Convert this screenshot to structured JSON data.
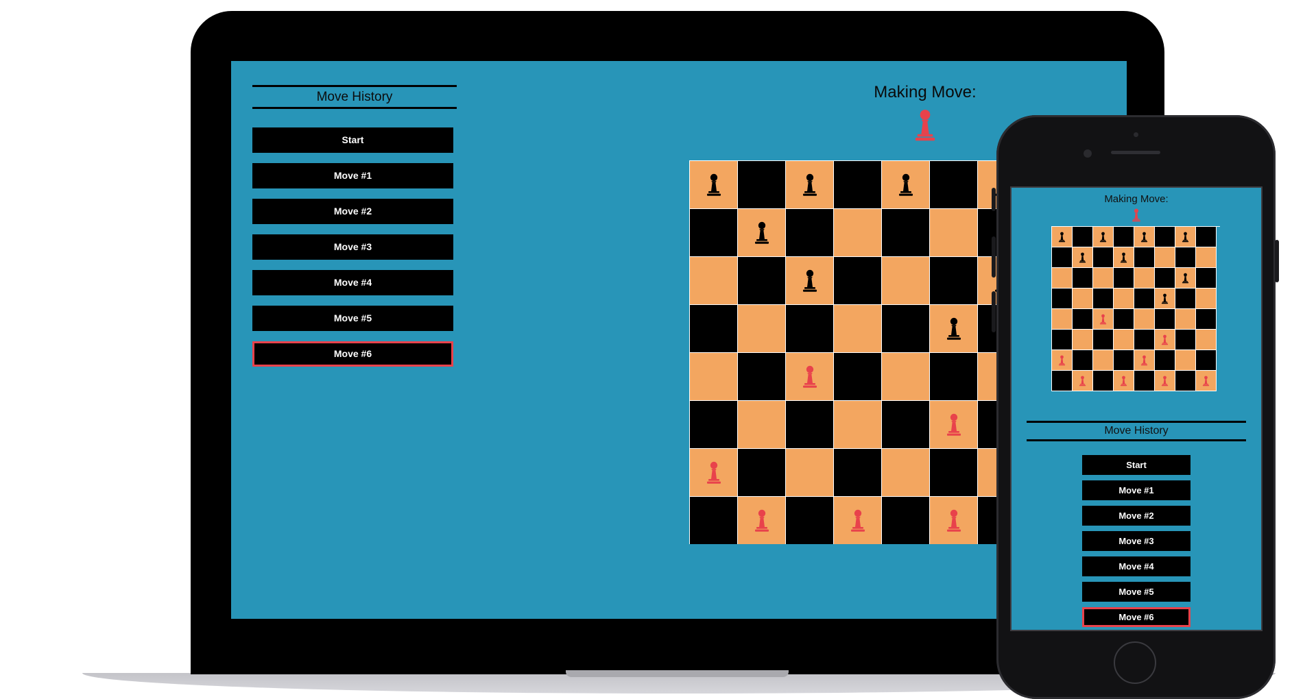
{
  "colors": {
    "background": "#2895b8",
    "light_square": "#f3a660",
    "dark_square": "#000000",
    "black_piece": "#000000",
    "red_piece": "#e8424b",
    "selected_border": "#e8424b"
  },
  "desktop": {
    "history_title": "Move History",
    "moves": [
      "Start",
      "Move #1",
      "Move #2",
      "Move #3",
      "Move #4",
      "Move #5",
      "Move #6"
    ],
    "selected_move": 6,
    "making_move_label": "Making Move:",
    "current_player": "red",
    "board_visible_columns": 6
  },
  "mobile": {
    "history_title": "Move History",
    "moves": [
      "Start",
      "Move #1",
      "Move #2",
      "Move #3",
      "Move #4",
      "Move #5",
      "Move #6"
    ],
    "selected_move": 6,
    "making_move_label": "Making Move:",
    "current_player": "red"
  },
  "board": {
    "icon": "pawn-icon",
    "rows": [
      [
        "b",
        "",
        "b",
        "",
        "b",
        "",
        "b",
        ""
      ],
      [
        "",
        "b",
        "",
        "",
        "",
        "",
        "",
        ""
      ],
      [
        "",
        "",
        "b",
        "",
        "",
        "",
        "b",
        ""
      ],
      [
        "",
        "",
        "",
        "",
        "",
        "b",
        "",
        ""
      ],
      [
        "",
        "",
        "r",
        "",
        "",
        "",
        "",
        ""
      ],
      [
        "",
        "",
        "",
        "",
        "",
        "r",
        "",
        ""
      ],
      [
        "r",
        "",
        "",
        "",
        "",
        "",
        "",
        ""
      ],
      [
        "",
        "r",
        "",
        "r",
        "",
        "r",
        "",
        "r"
      ]
    ]
  },
  "mobile_board": {
    "rows": [
      [
        "b",
        "",
        "b",
        "",
        "b",
        "",
        "b",
        ""
      ],
      [
        "",
        "b",
        "",
        "b",
        "",
        "",
        "",
        ""
      ],
      [
        "",
        "",
        "",
        "",
        "",
        "",
        "b",
        ""
      ],
      [
        "",
        "",
        "",
        "",
        "",
        "b",
        "",
        ""
      ],
      [
        "",
        "",
        "r",
        "",
        "",
        "",
        "",
        ""
      ],
      [
        "",
        "",
        "",
        "",
        "",
        "r",
        "",
        ""
      ],
      [
        "r",
        "",
        "",
        "",
        "r",
        "",
        "",
        ""
      ],
      [
        "",
        "r",
        "",
        "r",
        "",
        "r",
        "",
        "r"
      ]
    ]
  }
}
